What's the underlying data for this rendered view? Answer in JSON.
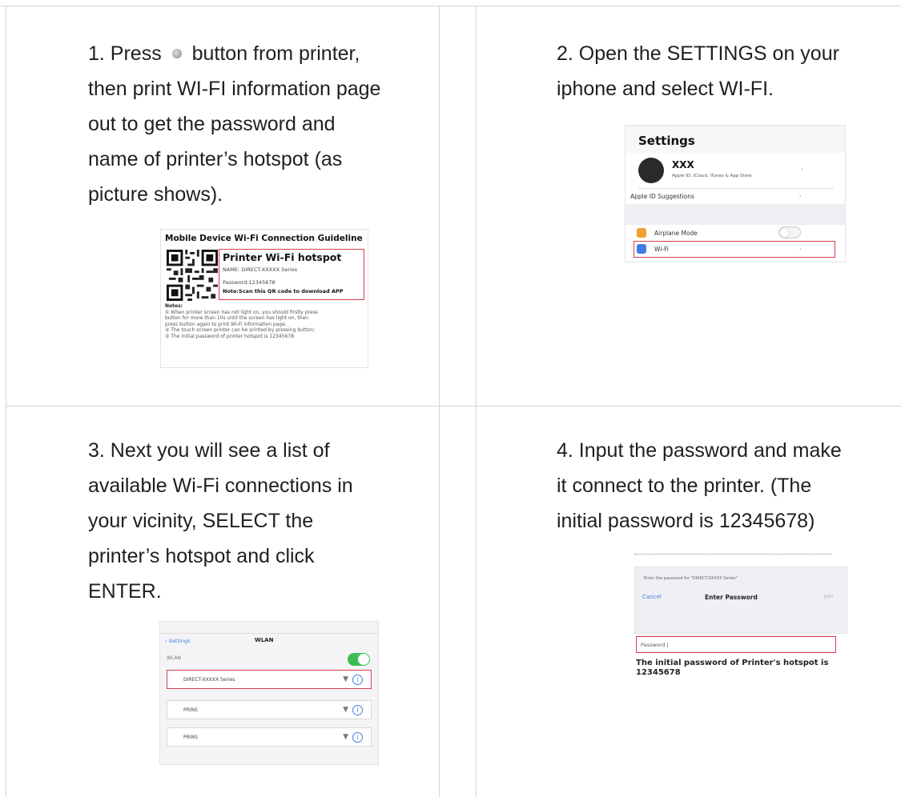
{
  "steps": [
    {
      "text_before_icon": "1. Press",
      "text_after_icon": "button from printer,",
      "lines": [
        "then print WI-FI information page",
        "out to get the password and",
        "name of printer’s hotspot (as",
        "picture shows)."
      ],
      "image": {
        "title": "Mobile Device Wi-Fi Connection Guideline",
        "hotspot_heading": "Printer Wi-Fi hotspot",
        "name_line": "NAME: DIRECT-XXXXX Series",
        "password_line": "Password:12345678",
        "note_line": "Note:Scan this QR code to download APP",
        "notes_heading": "Notes:",
        "notes": [
          "① When printer screen has not light on, you should firstly press",
          "button for more than 10s until the screen has light on, then",
          "press   button again to print Wi-Fi information page.",
          "② The touch screen printer can be printed by pressing   button;",
          "③ The initial password of printer hotspot is 12345678"
        ]
      }
    },
    {
      "lines": [
        "2. Open the SETTINGS on your",
        "iphone and select WI-FI."
      ],
      "image": {
        "title": "Settings",
        "account_name": "XXX",
        "account_sub": "Apple ID, iCloud, iTunes & App Store",
        "suggestions": "Apple ID Suggestions",
        "airplane": "Airplane Mode",
        "wifi": "Wi-Fi",
        "chevron": "›"
      }
    },
    {
      "lines": [
        "3. Next you will see a list of",
        "available Wi-Fi connections in",
        "your vicinity, SELECT the",
        "printer’s hotspot and click",
        "ENTER."
      ],
      "image": {
        "back": "‹ Settings",
        "title": "WLAN",
        "wlan_label": "WLAN",
        "networks": [
          "DIRECT-XXXXX Series",
          "PRINS",
          "PRINS"
        ],
        "info_glyph": "i"
      }
    },
    {
      "lines": [
        "4. Input the password and make",
        "it connect to the printer. (The",
        "initial password is 12345678)"
      ],
      "image": {
        "prompt": "Enter the password for \"DIRECT-XXXXX Series\"",
        "cancel": "Cancel",
        "enter_password": "Enter Password",
        "join": "Join",
        "field_label": "Password  |",
        "note": "The initial password of Printer's hotspot is 12345678"
      }
    }
  ]
}
